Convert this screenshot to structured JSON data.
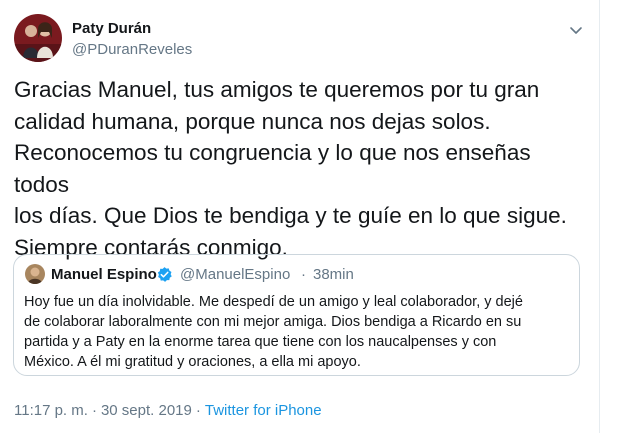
{
  "tweet": {
    "author": {
      "name": "Paty Durán",
      "handle": "@PDuranReveles"
    },
    "text": "Gracias Manuel, tus amigos te queremos por tu gran\ncalidad humana, porque nunca nos dejas solos.\nReconocemos tu congruencia y lo que nos enseñas todos\nlos días. Que Dios te bendiga y te guíe en lo que sigue.\nSiempre contarás conmigo.",
    "quoted": {
      "name": "Manuel Espino",
      "handle": "@ManuelEspino",
      "separator": "·",
      "time": "38min",
      "verified": true,
      "text": "Hoy fue un día inolvidable. Me despedí de un amigo y leal colaborador, y dejé\nde colaborar laboralmente con mi mejor amiga. Dios bendiga a Ricardo en su\npartida y a Paty en la enorme tarea que tiene con los naucalpenses y con\nMéxico. A él mi gratitud y oraciones, a ella mi apoyo."
    },
    "meta": {
      "time": "11:17 p. m.",
      "separator": "·",
      "date": "30 sept. 2019",
      "source": "Twitter for iPhone"
    }
  },
  "colors": {
    "text": "#14171a",
    "secondary": "#657786",
    "link": "#1b95e0",
    "border": "#ccd6dd",
    "verified": "#1da1f2"
  },
  "icons": [
    "avatar-photo",
    "chevron-down-icon",
    "verified-badge-icon"
  ]
}
